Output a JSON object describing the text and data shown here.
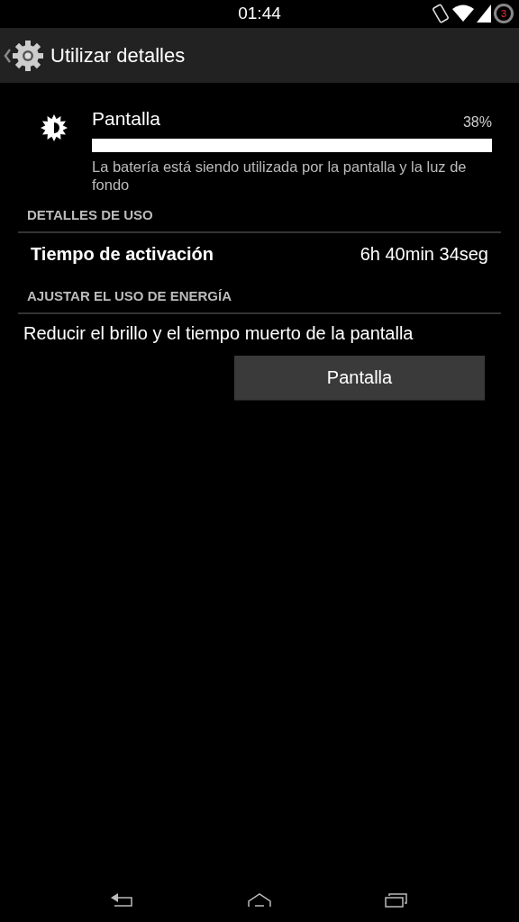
{
  "status_bar": {
    "time": "01:44",
    "battery_text": "3"
  },
  "action_bar": {
    "title": "Utilizar detalles"
  },
  "usage_item": {
    "name": "Pantalla",
    "percent": "38%",
    "level": 1,
    "description": "La batería está siendo utilizada por la pantalla y la luz de fondo"
  },
  "sections": [
    {
      "header": "DETALLES DE USO",
      "rows": [
        {
          "kind": "stat",
          "label": "Tiempo de activación",
          "value": "6h 40min 34seg"
        }
      ]
    },
    {
      "header": "AJUSTAR EL USO DE ENERGÍA",
      "rows": [
        {
          "kind": "action",
          "label": "Reducir el brillo y el tiempo muerto de la pantalla",
          "button": "Pantalla"
        }
      ]
    }
  ]
}
